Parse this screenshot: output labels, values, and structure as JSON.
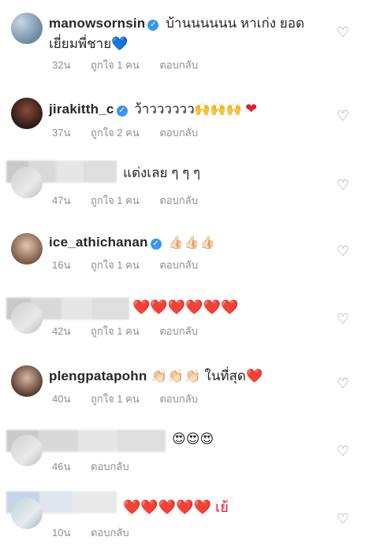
{
  "comments": [
    {
      "username": "manowsornsin",
      "verified": true,
      "text": "บ้านนนนนน หาเก่ง ยอดเยี่ยมพี่ชาย💙",
      "time": "32น",
      "likes": "ถูกใจ 1 คน",
      "reply": "ตอบกลับ"
    },
    {
      "username": "jirakitth_c",
      "verified": true,
      "text": "ว้าววววว🙌🙌🙌❤️",
      "time": "37น",
      "likes": "ถูกใจ 2 คน",
      "reply": "ตอบกลับ"
    },
    {
      "username": "",
      "verified": false,
      "text": "แต่งเลย ๆ ๆ ๆ",
      "time": "47น",
      "likes": "ถูกใจ 1 คน",
      "reply": "ตอบกลับ"
    },
    {
      "username": "ice_athichanan",
      "verified": true,
      "text": "👍🏻👍🏻👍🏻",
      "time": "16น",
      "likes": "ถูกใจ 1 คน",
      "reply": "ตอบกลับ"
    },
    {
      "username": "",
      "verified": false,
      "text": "❤️❤️❤️❤️❤️❤️",
      "time": "42น",
      "likes": "ถูกใจ 1 คน",
      "reply": "ตอบกลับ"
    },
    {
      "username": "plengpatapohn",
      "verified": false,
      "text": "👏🏻👏🏻👏🏻 ในที่สุด❤️",
      "time": "40น",
      "likes": "ถูกใจ 1 คน",
      "reply": "ตอบกลับ"
    },
    {
      "username": "",
      "verified": false,
      "text": "😍😍😍",
      "time": "46น",
      "likes": "",
      "reply": "ตอบกลับ"
    },
    {
      "username": "",
      "verified": false,
      "text": "❤️❤️❤️❤️❤️ เย้",
      "time": "10น",
      "likes": "",
      "reply": "ตอบกลับ"
    }
  ],
  "icons": {
    "like": "heart-outline-icon",
    "verified": "verified-badge-icon"
  },
  "colors": {
    "text": "#262626",
    "meta": "#8e8e8e",
    "verified": "#3897f0",
    "heart": "#e8182d"
  }
}
